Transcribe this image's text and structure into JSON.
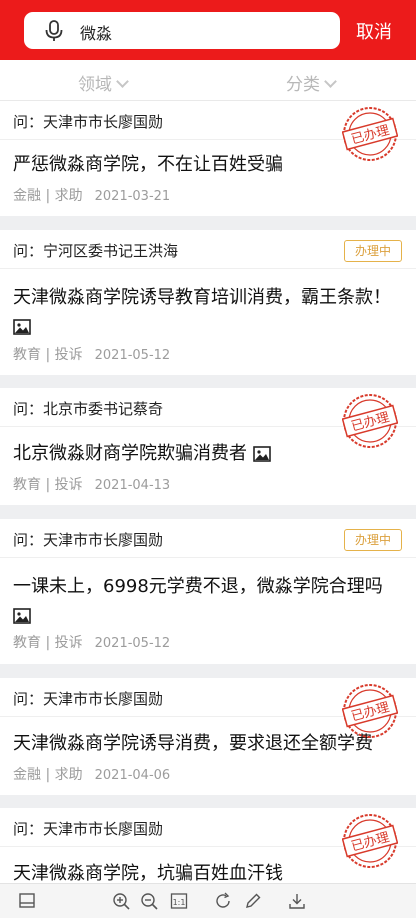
{
  "search": {
    "query": "微淼",
    "cancel_label": "取消"
  },
  "filters": {
    "domain_label": "领域",
    "category_label": "分类"
  },
  "colors": {
    "header": "#ec1b1b",
    "stamp": "#d83a2b",
    "badge": "#dba03d"
  },
  "status_labels": {
    "done": "已办理",
    "processing": "办理中"
  },
  "items": [
    {
      "question": "问：天津市市长廖国勋",
      "title": "严惩微淼商学院，不在让百姓受骗",
      "has_image": false,
      "category": "金融",
      "type": "求助",
      "date": "2021-03-21",
      "status": "done"
    },
    {
      "question": "问：宁河区委书记王洪海",
      "title": "天津微淼商学院诱导教育培训消费，霸王条款！",
      "has_image": true,
      "category": "教育",
      "type": "投诉",
      "date": "2021-05-12",
      "status": "processing"
    },
    {
      "question": "问：北京市委书记蔡奇",
      "title": "北京微淼财商学院欺骗消费者",
      "has_image": true,
      "category": "教育",
      "type": "投诉",
      "date": "2021-04-13",
      "status": "done"
    },
    {
      "question": "问：天津市市长廖国勋",
      "title": "一课未上，6998元学费不退，微淼学院合理吗",
      "has_image": true,
      "category": "教育",
      "type": "投诉",
      "date": "2021-05-12",
      "status": "processing"
    },
    {
      "question": "问：天津市市长廖国勋",
      "title": "天津微淼商学院诱导消费，要求退还全额学费",
      "has_image": false,
      "category": "金融",
      "type": "求助",
      "date": "2021-04-06",
      "status": "done"
    },
    {
      "question": "问：天津市市长廖国勋",
      "title": "天津微淼商学院，坑骗百姓血汗钱",
      "has_image": false,
      "category": "",
      "type": "",
      "date": "",
      "status": "done"
    }
  ],
  "toolbar_icons": [
    "panel-icon",
    "zoom-in-icon",
    "zoom-out-icon",
    "actual-size-icon",
    "rotate-icon",
    "edit-icon",
    "download-icon"
  ],
  "toolbar_fit_label": "1:1"
}
